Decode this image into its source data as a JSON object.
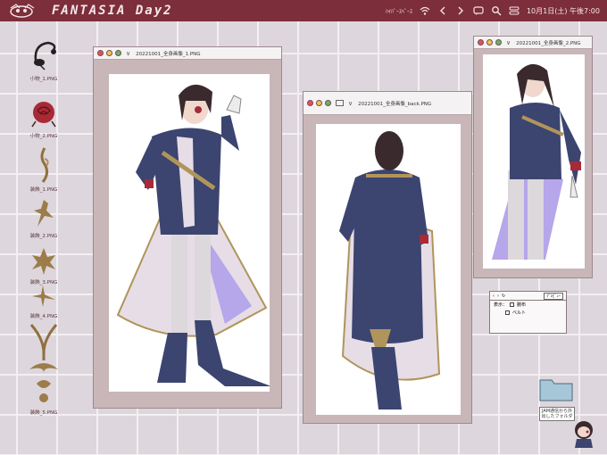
{
  "topbar": {
    "title": "FANTASIA Day2",
    "status_small": "ﾊｲﾊﾟｰｽﾍﾟｰｽ",
    "datetime": "10月1日(土) 午後7:00"
  },
  "sidebar": {
    "files": [
      {
        "label": "小物_1.PNG",
        "icon": "headset-icon"
      },
      {
        "label": "小物_2.PNG",
        "icon": "rose-icon"
      },
      {
        "label": "装飾_1.PNG",
        "icon": "ornament-icon"
      },
      {
        "label": "装飾_2.PNG",
        "icon": "ornament-icon"
      },
      {
        "label": "装飾_3.PNG",
        "icon": "ornament-icon"
      },
      {
        "label": "装飾_4.PNG",
        "icon": "ornament-icon"
      },
      {
        "label": "装飾_5.PNG",
        "icon": "ornament-icon"
      }
    ]
  },
  "windows": {
    "front": {
      "title": "20221001_全身画像_1.PNG"
    },
    "back": {
      "title": "20221001_全身画像_back.PNG"
    },
    "side": {
      "title": "20221001_全身画像_2.PNG"
    }
  },
  "dialog": {
    "button": "ﾌﾟﾚﾋﾞｭｰ",
    "display_label": "表示：",
    "options": [
      "腕布",
      "ベルト"
    ]
  },
  "folder": {
    "label": "JAM通信から外 出したフォルダ"
  },
  "colors": {
    "topbar": "#7c2e3a",
    "coat": "#3c4470",
    "gold": "#b0955a",
    "cape": "#e6dde6",
    "lining": "#b6a6ea"
  }
}
